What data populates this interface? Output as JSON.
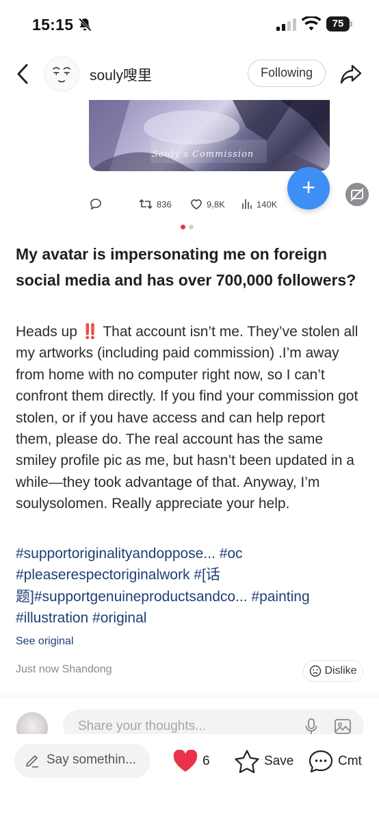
{
  "status_bar": {
    "time": "15:15",
    "battery": "75"
  },
  "header": {
    "author_name": "souly嗖里",
    "follow_label": "Following",
    "icons": {
      "back": "back-chevron-icon",
      "share": "share-arrow-icon"
    }
  },
  "media": {
    "artwork_text": "Souly's Commission",
    "stats": {
      "reposts": "836",
      "likes": "9,8K",
      "views": "140K"
    },
    "carousel_pages": 2,
    "carousel_active": 1,
    "accent_color": "#3d8ff5"
  },
  "post": {
    "title": "My avatar is impersonating me on foreign social media and has over 700,000 followers?",
    "body_prefix": "Heads up ",
    "body_warn": "‼️",
    "body_rest": " That account isn’t me. They’ve stolen all my artworks (including paid commission) .I’m away from home with no computer right now, so I can’t confront them directly. If you find your commission got stolen, or if you have access and can help report them, please do. The real account has the same smiley profile pic as me, but hasn’t been updated in a while—they took advantage of that. Anyway, I’m soulysolomen. Really appreciate your help.",
    "tags": "#supportoriginalityandoppose... #oc #pleaserespectoriginalwork #[话题]#supportgenuineproductsandco... #painting #illustration #original",
    "see_original": "See original",
    "meta": "Just now Shandong",
    "dislike_label": "Dislike"
  },
  "comment_input": {
    "placeholder": "Share your thoughts..."
  },
  "bottom_bar": {
    "say_placeholder": "Say somethin...",
    "like_count": "6",
    "save_label": "Save",
    "comment_label": "Cmt"
  }
}
